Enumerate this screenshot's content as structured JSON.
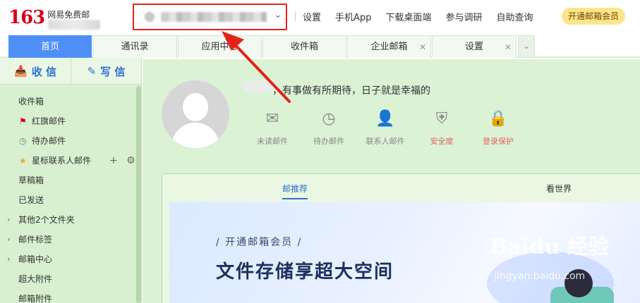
{
  "header": {
    "logo_num": "163",
    "logo_text": "网易免费邮",
    "nav": [
      "设置",
      "手机App",
      "下载桌面端",
      "参与调研",
      "自助查询"
    ],
    "vip": "开通邮箱会员"
  },
  "tabs": [
    {
      "label": "首页",
      "closable": false,
      "active": true
    },
    {
      "label": "通讯录",
      "closable": false,
      "active": false
    },
    {
      "label": "应用中心",
      "closable": false,
      "active": false
    },
    {
      "label": "收件箱",
      "closable": false,
      "active": false
    },
    {
      "label": "企业邮箱",
      "closable": true,
      "active": false
    },
    {
      "label": "设置",
      "closable": true,
      "active": false
    }
  ],
  "sidebar": {
    "receive": "收 信",
    "compose": "写 信",
    "folders": [
      {
        "label": "收件箱"
      },
      {
        "label": "红旗邮件",
        "icon": "flag"
      },
      {
        "label": "待办邮件",
        "icon": "clock"
      },
      {
        "label": "星标联系人邮件",
        "icon": "star",
        "tools": "+ ⚙"
      },
      {
        "label": "草稿箱"
      },
      {
        "label": "已发送"
      },
      {
        "label": "其他2个文件夹",
        "caret": true
      },
      {
        "label": "邮件标签",
        "caret": true
      },
      {
        "label": "邮箱中心",
        "caret": true
      },
      {
        "label": "超大附件"
      },
      {
        "label": "邮箱附件"
      }
    ]
  },
  "main": {
    "greeting": "，有事做有所期待，日子就是幸福的",
    "quick_links": [
      {
        "label": "未读邮件",
        "icon": "mail-icon",
        "glyph": "✉"
      },
      {
        "label": "待办邮件",
        "icon": "clock-icon",
        "glyph": "◷"
      },
      {
        "label": "联系人邮件",
        "icon": "contact-icon",
        "glyph": "👤"
      },
      {
        "label": "安全度",
        "icon": "shield-icon",
        "glyph": "⛨"
      },
      {
        "label": "登录保护",
        "icon": "lock-icon",
        "glyph": "🔒"
      }
    ],
    "panel_tabs": [
      "邮推荐",
      "看世界"
    ],
    "banner_sub": "/ 开通邮箱会员 /",
    "banner_title": "文件存储享超大空间"
  },
  "watermark": {
    "main": "Baidu 经验",
    "sub": "jingyan.baidu.com"
  },
  "colors": {
    "brand_red": "#d6001c",
    "accent_blue": "#4f8ff7",
    "sidebar_green": "#d8f0d0",
    "highlight_red": "#e2231a"
  }
}
